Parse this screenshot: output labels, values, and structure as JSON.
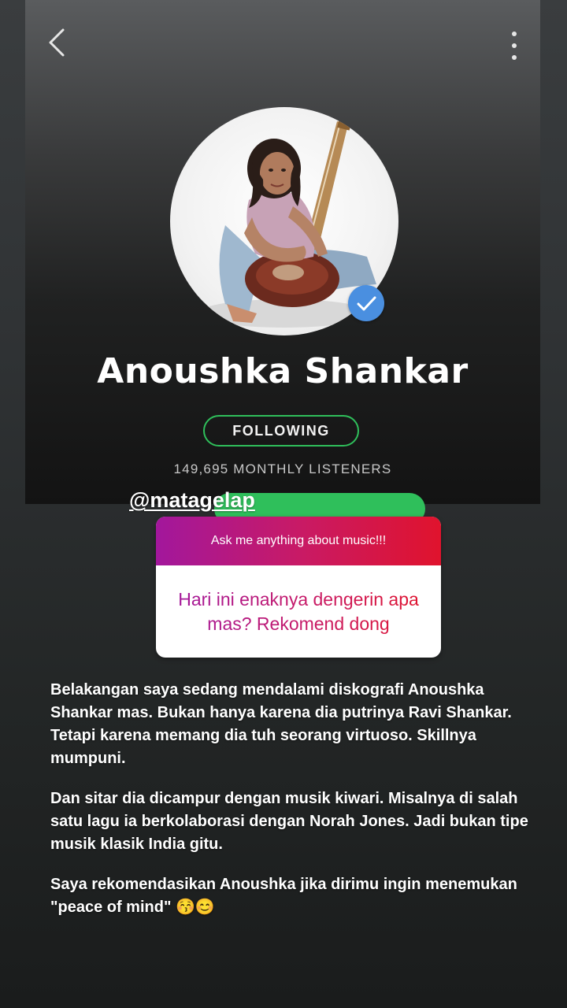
{
  "profile": {
    "artist_name": "Anoushka Shankar",
    "follow_label": "FOLLOWING",
    "listeners": "149,695 MONTHLY LISTENERS",
    "accent_color": "#2fbf5b",
    "verified_badge_color": "#4a8fe0"
  },
  "story": {
    "mention": "@matagelap",
    "question_prompt": "Ask me anything about music!!!",
    "question_answer": "Hari ini enaknya dengerin apa mas? Rekomend dong",
    "paragraphs": [
      "Belakangan saya sedang mendalami diskografi Anoushka Shankar mas. Bukan hanya karena dia putrinya Ravi Shankar. Tetapi karena memang dia tuh seorang virtuoso. Skillnya mumpuni.",
      "Dan sitar dia dicampur dengan musik kiwari. Misalnya di salah satu lagu ia berkolaborasi dengan Norah Jones. Jadi bukan tipe musik klasik India gitu.",
      "Saya rekomendasikan Anoushka jika dirimu ingin menemukan \"peace of mind\" 😚😊"
    ]
  },
  "icons": {
    "back": "chevron-left-icon",
    "more": "more-vertical-icon",
    "verified": "check-icon"
  }
}
